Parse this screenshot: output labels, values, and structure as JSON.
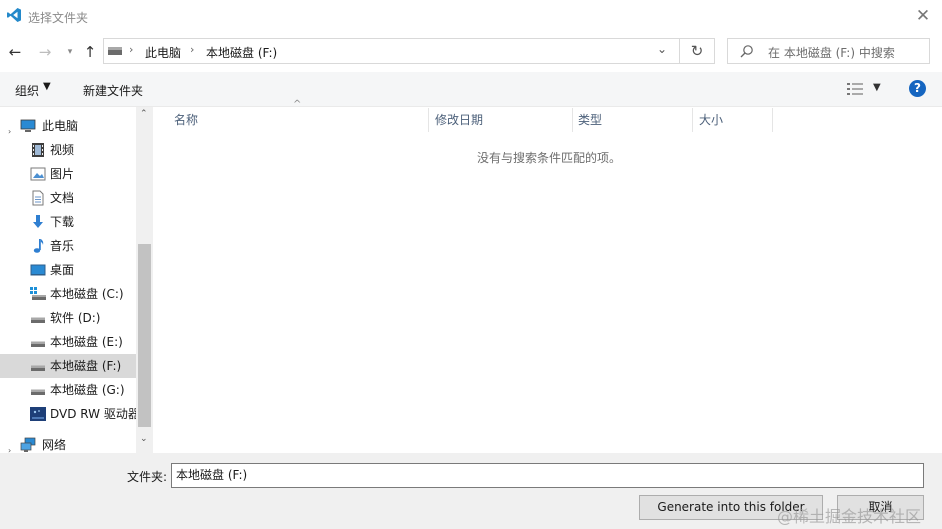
{
  "window": {
    "title": "选择文件夹"
  },
  "nav": {
    "breadcrumb": [
      "此电脑",
      "本地磁盘 (F:)"
    ],
    "search_placeholder": "在 本地磁盘 (F:) 中搜索"
  },
  "toolbar": {
    "organize": "组织",
    "new_folder": "新建文件夹"
  },
  "sidebar": {
    "items": [
      {
        "label": "此电脑",
        "icon": "computer-icon"
      },
      {
        "label": "视频",
        "icon": "video-folder-icon"
      },
      {
        "label": "图片",
        "icon": "pictures-folder-icon"
      },
      {
        "label": "文档",
        "icon": "documents-folder-icon"
      },
      {
        "label": "下载",
        "icon": "download-arrow-icon"
      },
      {
        "label": "音乐",
        "icon": "music-note-icon"
      },
      {
        "label": "桌面",
        "icon": "desktop-icon"
      },
      {
        "label": "本地磁盘 (C:)",
        "icon": "system-drive-icon"
      },
      {
        "label": "软件 (D:)",
        "icon": "drive-icon"
      },
      {
        "label": "本地磁盘 (E:)",
        "icon": "drive-icon"
      },
      {
        "label": "本地磁盘 (F:)",
        "icon": "drive-icon",
        "selected": true
      },
      {
        "label": "本地磁盘 (G:)",
        "icon": "drive-icon"
      },
      {
        "label": "DVD RW 驱动器",
        "icon": "dvd-drive-icon"
      },
      {
        "label": "网络",
        "icon": "network-icon"
      }
    ]
  },
  "columns": [
    "名称",
    "修改日期",
    "类型",
    "大小"
  ],
  "empty_message": "没有与搜索条件匹配的项。",
  "bottom": {
    "folder_label": "文件夹:",
    "folder_value": "本地磁盘 (F:)",
    "generate_button": "Generate into this folder",
    "cancel_button": "取消"
  },
  "watermark": "@稀土掘金技术社区",
  "colors": {
    "accent": "#1e73be",
    "help": "#1565c0",
    "selected_bg": "#d9d9d9",
    "vscode_blue": "#2489ca"
  }
}
